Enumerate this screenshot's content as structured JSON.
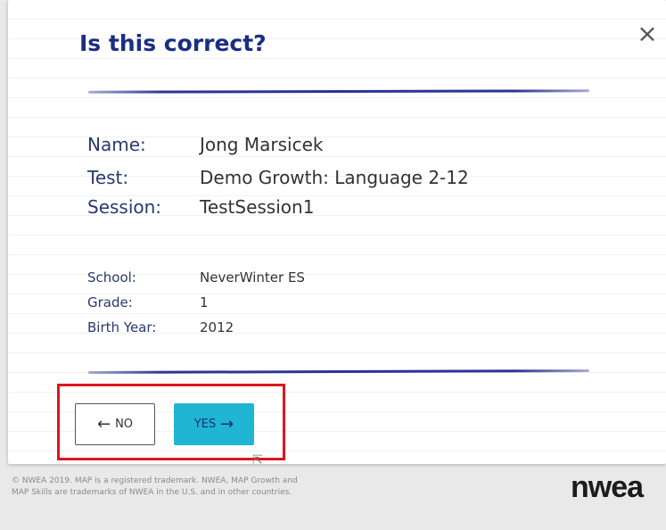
{
  "dialog": {
    "title": "Is this correct?",
    "close_icon": "×"
  },
  "primary_info": [
    {
      "label": "Name:",
      "value": "Jong Marsicek"
    },
    {
      "label": "Test:",
      "value": "Demo Growth: Language 2-12"
    },
    {
      "label": "Session:",
      "value": "TestSession1"
    }
  ],
  "secondary_info": [
    {
      "label": "School:",
      "value": "NeverWinter ES"
    },
    {
      "label": "Grade:",
      "value": "1"
    },
    {
      "label": "Birth Year:",
      "value": "2012"
    }
  ],
  "buttons": {
    "no_label": "NO",
    "yes_label": "YES",
    "no_icon": "arrow-left-icon",
    "yes_icon": "arrow-right-icon"
  },
  "footer": {
    "copyright_line1": "© NWEA 2019. MAP is a registered trademark. NWEA, MAP Growth and",
    "copyright_line2": "MAP Skills are trademarks of NWEA in the U.S. and in other countries.",
    "logo": "nwea"
  },
  "colors": {
    "title": "#1a2e82",
    "yes_button": "#1fb5d3",
    "highlight_box": "#e0141e"
  }
}
